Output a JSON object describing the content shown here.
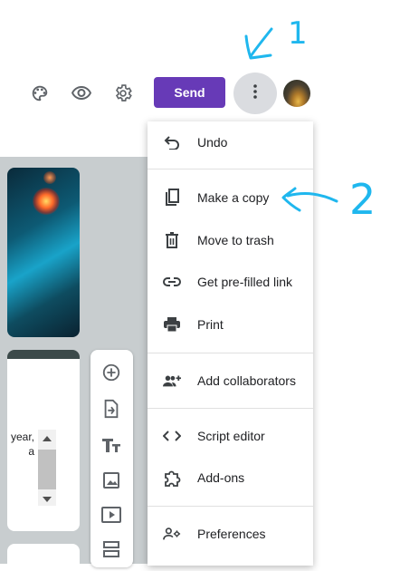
{
  "toolbar": {
    "icons": [
      "palette-icon",
      "eye-icon",
      "gear-icon",
      "more-vert-icon"
    ],
    "send_label": "Send"
  },
  "form_preview": {
    "question_text": "year, a",
    "question_line1": "year,",
    "question_line2": "a"
  },
  "side_tools": [
    "add-question-icon",
    "import-questions-icon",
    "add-title-icon",
    "add-image-icon",
    "add-video-icon",
    "add-section-icon"
  ],
  "menu": {
    "items": [
      {
        "label": "Undo",
        "icon": "undo-icon"
      },
      {
        "label": "Make a copy",
        "icon": "copy-icon"
      },
      {
        "label": "Move to trash",
        "icon": "trash-icon"
      },
      {
        "label": "Get pre-filled link",
        "icon": "link-icon"
      },
      {
        "label": "Print",
        "icon": "print-icon"
      },
      {
        "label": "Add collaborators",
        "icon": "add-people-icon"
      },
      {
        "label": "Script editor",
        "icon": "code-icon"
      },
      {
        "label": "Add-ons",
        "icon": "puzzle-icon"
      },
      {
        "label": "Preferences",
        "icon": "person-settings-icon"
      }
    ]
  },
  "annotations": {
    "label_1": "1",
    "label_2": "2",
    "color": "#1fb7ee"
  },
  "colors": {
    "send_button": "#673ab7",
    "menu_button_bg": "#dadce0"
  }
}
